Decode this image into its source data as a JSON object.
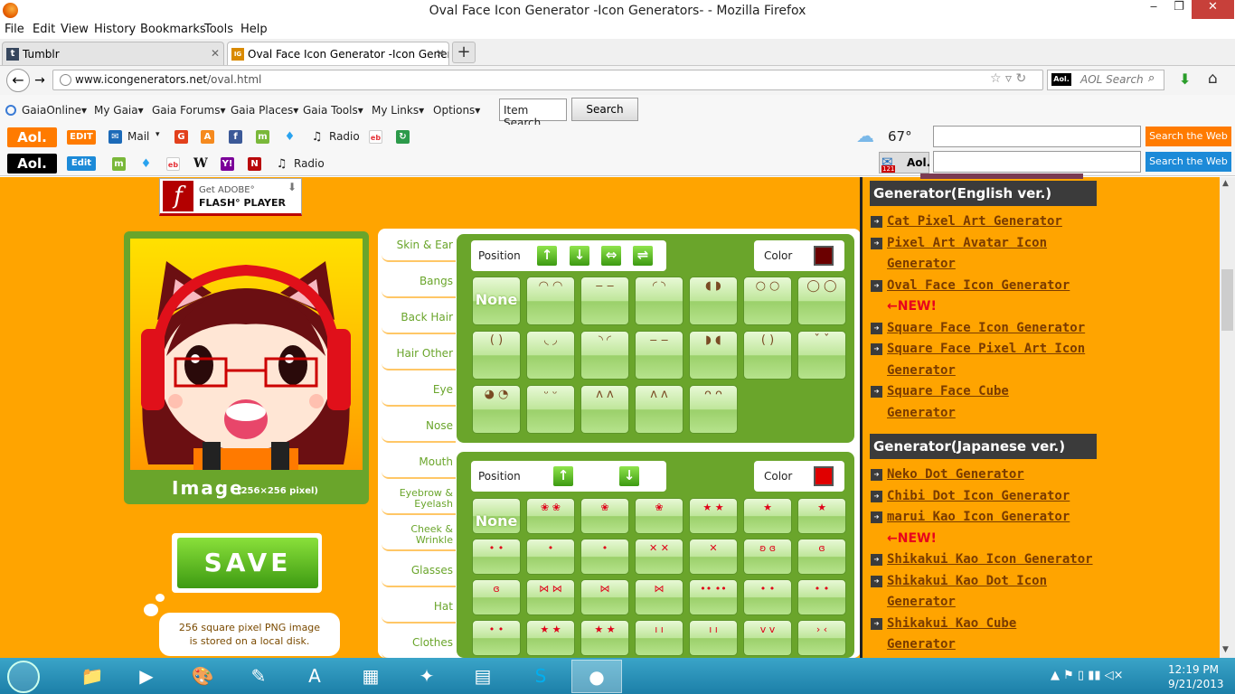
{
  "window": {
    "title": "Oval Face Icon Generator -Icon Generators- - Mozilla Firefox",
    "min": "‒",
    "max": "❐",
    "close": "✕"
  },
  "menu": [
    "File",
    "Edit",
    "View",
    "History",
    "Bookmarks",
    "Tools",
    "Help"
  ],
  "tabs": [
    {
      "label": "Tumblr",
      "fav": "t"
    },
    {
      "label": "Oval Face Icon Generator -Icon Gener...",
      "fav": "IG"
    }
  ],
  "newtab": "+",
  "nav": {
    "back": "←",
    "forward": "→",
    "url_host": "www.icongenerators.net",
    "url_path": "/oval.html",
    "url_icons": "☆ ▿ ↻",
    "search_placeholder": "AOL Search",
    "search_icon": "⌕",
    "download_icon": "⬇",
    "home_icon": "⌂"
  },
  "gaia": {
    "items": [
      "GaiaOnline▾",
      "My Gaia▾",
      "Gaia Forums▾",
      "Gaia Places▾",
      "Gaia Tools▾",
      "My Links▾",
      "Options▾"
    ],
    "item_search_value": "Item Search...",
    "search_button": "Search"
  },
  "aol1": {
    "logo": "Aol.",
    "edit": "EDIT",
    "mail": "Mail",
    "mail_caret": "▾",
    "radio": "Radio",
    "weather": "67°",
    "search_button": "Search the Web"
  },
  "aol2": {
    "logo": "Aol.",
    "edit": "Edit",
    "radio": "Radio",
    "mail_badge": "121",
    "aol_label": "Aol.",
    "search_button": "Search the Web"
  },
  "flash": {
    "f": "f",
    "line1": "Get ADOBE°",
    "line2": "FLASH° PLAYER"
  },
  "preview": {
    "label": "Image",
    "sub": "(256×256 pixel)"
  },
  "save": {
    "label": "SAVE"
  },
  "bubble": {
    "line1": "256 square pixel PNG image",
    "line2": "is stored on a local disk."
  },
  "categories": [
    "Skin & Ear",
    "Bangs",
    "Back Hair",
    "Hair Other",
    "Eye",
    "Nose",
    "Mouth",
    "Eyebrow &\nEyelash",
    "Cheek &\nWrinkle",
    "Glasses",
    "Hat",
    "Clothes"
  ],
  "panel_top": {
    "position_label": "Position",
    "color_label": "Color",
    "color_value": "#6b0000",
    "arrows": [
      "↑",
      "↓",
      "⇔",
      "⇌"
    ],
    "cells": [
      "None",
      "◠ ◠",
      "‒ ‒",
      "◜ ◝",
      "◖ ◗",
      "○ ○",
      "◯ ◯",
      "( )",
      "◟ ◞",
      "◝ ◜",
      "‒ ‒",
      "◗ ◖",
      "( )",
      "ˇ ˇ",
      "◕ ◔",
      "ᵕ ᵕ",
      "ʌ ʌ",
      "ʌ ʌ",
      "ᴖ ᴖ"
    ]
  },
  "panel_bottom": {
    "position_label": "Position",
    "color_label": "Color",
    "color_value": "#e00000",
    "arrows": [
      "↑",
      "↓"
    ],
    "cells": [
      "None",
      "❀ ❀",
      "❀",
      "❀",
      "★ ★",
      "★",
      "★",
      "• •",
      "•",
      "•",
      "✕ ✕",
      "✕",
      "ʚ ɞ",
      "ɞ",
      "ɞ",
      "⋈ ⋈",
      "⋈",
      "⋈",
      "•• ••",
      "• •",
      "• •",
      "• •",
      "★ ★",
      "★ ★",
      "ı ı",
      "ı ı",
      "v v",
      "› ‹"
    ]
  },
  "sidebar": {
    "head_en": "Generator(English ver.)",
    "links_en": [
      {
        "l1": "Cat Pixel Art Generator"
      },
      {
        "l1": "Pixel Art Avatar Icon",
        "l2": "Generator"
      },
      {
        "l1": "Oval Face Icon Generator",
        "new": "←NEW!"
      },
      {
        "l1": "Square Face Icon Generator"
      },
      {
        "l1": "Square Face Pixel Art Icon",
        "l2": "Generator"
      },
      {
        "l1": "Square Face Cube",
        "l2": "Generator"
      }
    ],
    "head_jp": "Generator(Japanese ver.)",
    "links_jp": [
      {
        "l1": "Neko Dot Generator"
      },
      {
        "l1": "Chibi Dot Icon Generator"
      },
      {
        "l1": "marui Kao Icon Generator",
        "new": "←NEW!"
      },
      {
        "l1": "Shikakui Kao Icon Generator"
      },
      {
        "l1": "Shikakui Kao Dot Icon",
        "l2": "Generator"
      },
      {
        "l1": "Shikakui Kao Cube",
        "l2": "Generator"
      }
    ]
  },
  "taskbar": {
    "time": "12:19 PM",
    "date": "9/21/2013",
    "tray": "▲ ⚑ ▯ ▮▮ ◁×"
  },
  "colors": {
    "page_bg": "#ffa400",
    "green": "#6aa52b",
    "aol_orange": "#ff7b00",
    "aol_black": "#000000",
    "aol_edit_blue": "#1c8ad8"
  }
}
